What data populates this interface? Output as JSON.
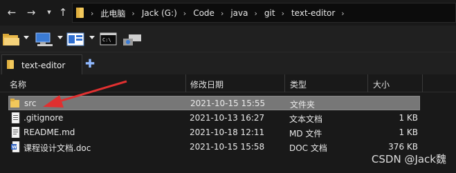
{
  "addressbar": {
    "breadcrumbs": [
      "此电脑",
      "Jack (G:)",
      "Code",
      "java",
      "git",
      "text-editor"
    ]
  },
  "tab": {
    "label": "text-editor"
  },
  "columns": {
    "name": "名称",
    "modified": "修改日期",
    "type": "类型",
    "size": "大小"
  },
  "files": [
    {
      "name": "src",
      "modified": "2021-10-15 15:55",
      "type": "文件夹",
      "size": "",
      "icon": "folder-icon",
      "selected": true
    },
    {
      "name": ".gitignore",
      "modified": "2021-10-13 16:27",
      "type": "文本文档",
      "size": "1 KB",
      "icon": "text-file-icon"
    },
    {
      "name": "README.md",
      "modified": "2021-10-18 12:11",
      "type": "MD 文件",
      "size": "1 KB",
      "icon": "md-file-icon"
    },
    {
      "name": "课程设计文档.doc",
      "modified": "2021-10-15 15:58",
      "type": "DOC 文档",
      "size": "376 KB",
      "icon": "word-doc-icon"
    }
  ],
  "watermark": "CSDN @Jack魏",
  "colors": {
    "selection": "#777777",
    "background": "#191919",
    "arrow": "#e03030"
  }
}
